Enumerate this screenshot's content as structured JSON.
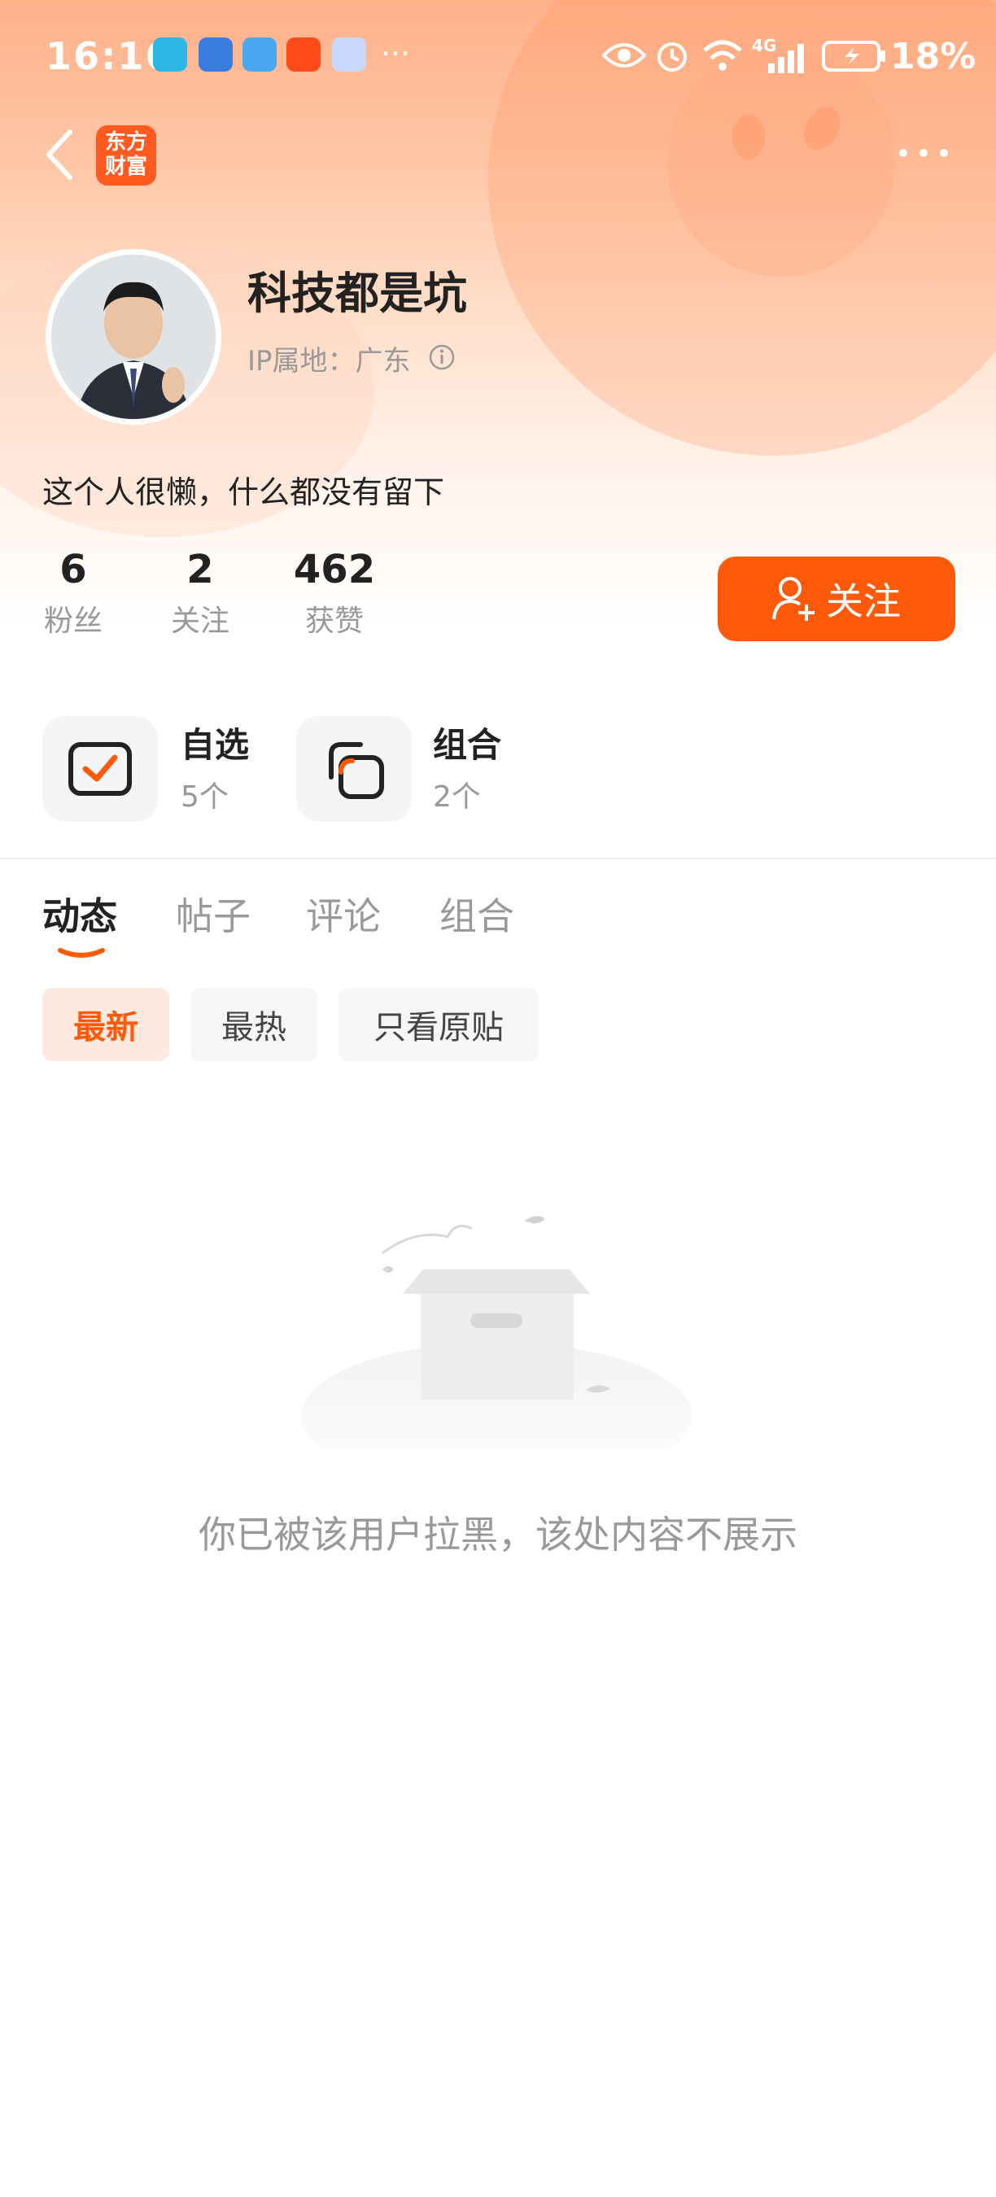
{
  "status_bar": {
    "time": "16:16",
    "more": "···",
    "network": "4G",
    "battery": "18%"
  },
  "header": {
    "brand_line1": "东方",
    "brand_line2": "财富"
  },
  "profile": {
    "username": "科技都是坑",
    "ip_location": "IP属地：广东",
    "bio": "这个人很懒，什么都没有留下",
    "stats": [
      {
        "value": "6",
        "label": "粉丝"
      },
      {
        "value": "2",
        "label": "关注"
      },
      {
        "value": "462",
        "label": "获赞"
      }
    ],
    "follow_label": "关注"
  },
  "features": [
    {
      "title": "自选",
      "count": "5个"
    },
    {
      "title": "组合",
      "count": "2个"
    }
  ],
  "tabs": [
    "动态",
    "帖子",
    "评论",
    "组合"
  ],
  "filters": [
    "最新",
    "最热",
    "只看原贴"
  ],
  "empty_state": {
    "message": "你已被该用户拉黑，该处内容不展示"
  },
  "colors": {
    "accent": "#ff5a0a",
    "brand": "#ff5a1f",
    "muted_text": "#999999"
  }
}
